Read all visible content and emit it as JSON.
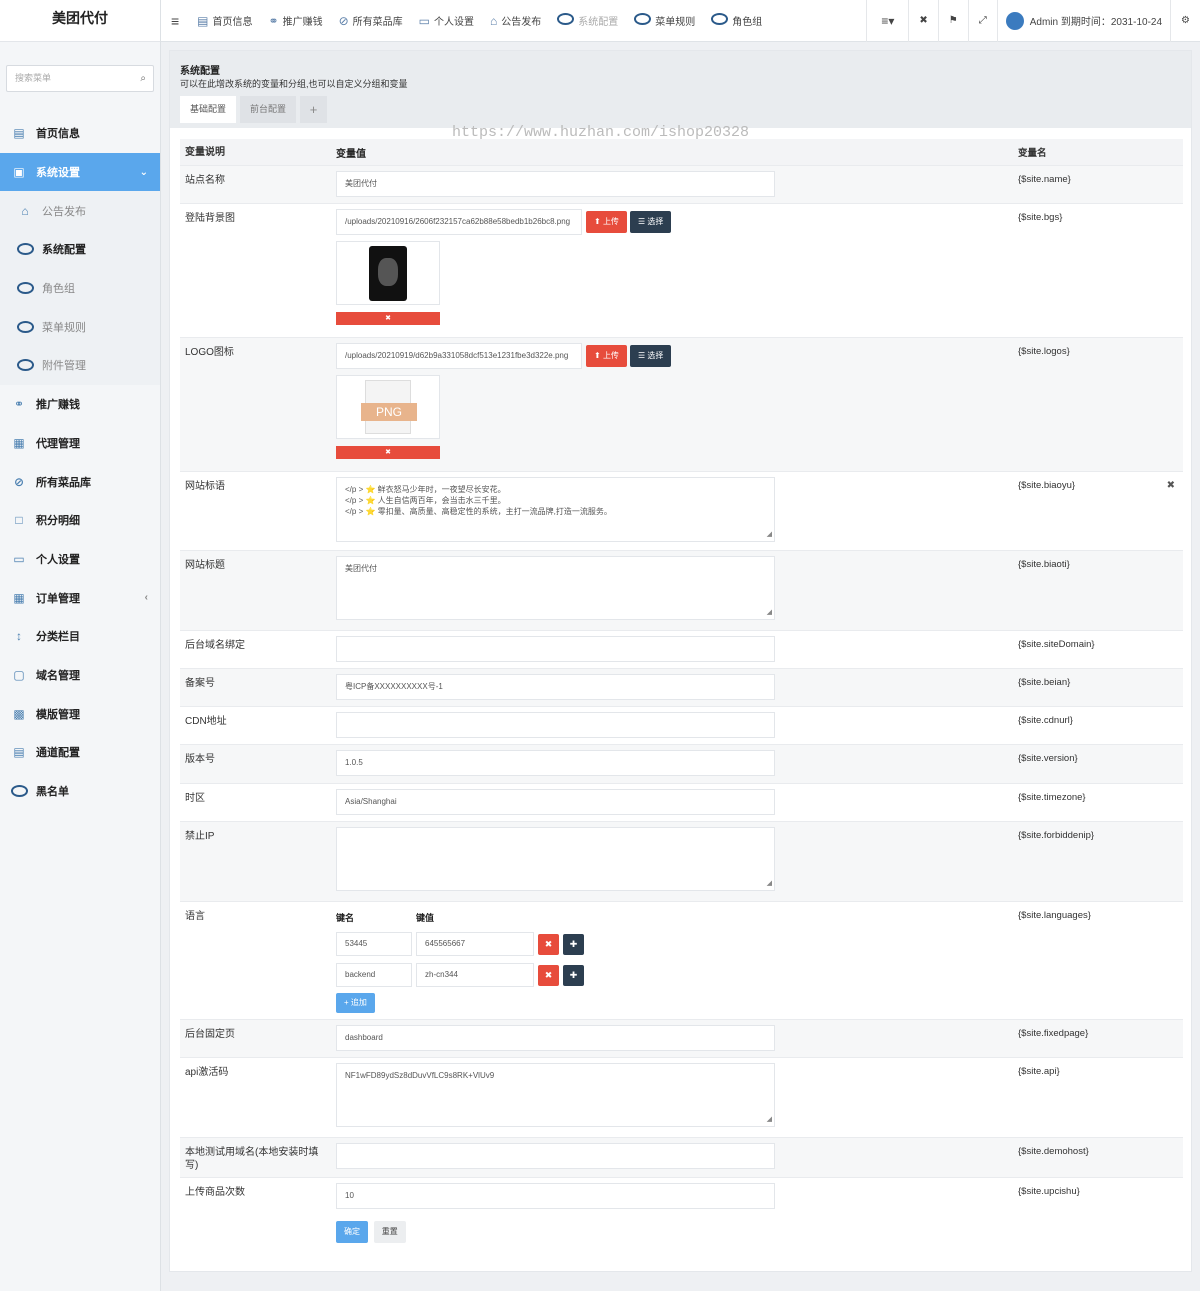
{
  "sidebar": {
    "brand": "美团代付",
    "search_placeholder": "搜索菜单",
    "items": [
      {
        "label": "首页信息",
        "icon": "home-icon"
      },
      {
        "label": "系统设置",
        "icon": "settings-icon",
        "active": true
      },
      {
        "label": "公告发布",
        "icon": "announce-icon"
      },
      {
        "label": "系统配置",
        "icon": "circle-icon",
        "current": true
      },
      {
        "label": "角色组",
        "icon": "circle-icon"
      },
      {
        "label": "菜单规则",
        "icon": "circle-icon"
      },
      {
        "label": "附件管理",
        "icon": "circle-icon"
      },
      {
        "label": "推广赚钱",
        "icon": "promote-icon"
      },
      {
        "label": "代理管理",
        "icon": "agent-icon"
      },
      {
        "label": "所有菜品库",
        "icon": "dishes-icon"
      },
      {
        "label": "积分明细",
        "icon": "points-icon"
      },
      {
        "label": "个人设置",
        "icon": "profile-icon"
      },
      {
        "label": "订单管理",
        "icon": "order-icon"
      },
      {
        "label": "分类栏目",
        "icon": "category-icon"
      },
      {
        "label": "域名管理",
        "icon": "domain-icon"
      },
      {
        "label": "模版管理",
        "icon": "template-icon"
      },
      {
        "label": "通道配置",
        "icon": "channel-icon"
      },
      {
        "label": "黑名单",
        "icon": "circle-icon"
      }
    ]
  },
  "topbar": {
    "menu_toggle": "≡",
    "tabs": [
      "首页信息",
      "推广赚钱",
      "所有菜品库",
      "个人设置",
      "公告发布",
      "系统配置",
      "菜单规则",
      "角色组"
    ],
    "admin": "Admin 到期时间：2031-10-24"
  },
  "panel": {
    "title": "系统配置",
    "subtitle": "可以在此增改系统的变量和分组,也可以自定义分组和变量",
    "tabs": [
      "基础配置",
      "前台配置"
    ],
    "watermark": "https://www.huzhan.com/ishop20328",
    "headers": {
      "desc": "变量说明",
      "value": "变量值",
      "name": "变量名"
    },
    "upload_label": "上传",
    "choose_label": "选择",
    "rows": {
      "site_name": {
        "label": "站点名称",
        "value": "美团代付",
        "var": "{$site.name}"
      },
      "bgs": {
        "label": "登陆背景图",
        "value": "/uploads/20210916/2606f232157ca62b88e58bedb1b26bc8.png",
        "var": "{$site.bgs}"
      },
      "logos": {
        "label": "LOGO图标",
        "value": "/uploads/20210919/d62b9a331058dcf513e1231fbe3d322e.png",
        "var": "{$site.logos}",
        "thumb_text": "PNG"
      },
      "biaoyu": {
        "label": "网站标语",
        "line1": "</p > ⭐ 鲜衣怒马少年时，一夜望尽长安花。",
        "line2": "</p > ⭐ 人生自信两百年，会当击水三千里。",
        "line3": "</p > ⭐ 零扣量、高质量、高稳定性的系统，主打一流品牌,打造一流服务。",
        "var": "{$site.biaoyu}"
      },
      "biaoti": {
        "label": "网站标题",
        "value": "美团代付",
        "var": "{$site.biaoti}"
      },
      "domain": {
        "label": "后台域名绑定",
        "value": "",
        "var": "{$site.siteDomain}"
      },
      "beian": {
        "label": "备案号",
        "value": "粤ICP备XXXXXXXXXX号-1",
        "var": "{$site.beian}"
      },
      "cdn": {
        "label": "CDN地址",
        "value": "",
        "var": "{$site.cdnurl}"
      },
      "version": {
        "label": "版本号",
        "value": "1.0.5",
        "var": "{$site.version}"
      },
      "timezone": {
        "label": "时区",
        "value": "Asia/Shanghai",
        "var": "{$site.timezone}"
      },
      "forbidden": {
        "label": "禁止IP",
        "value": "",
        "var": "{$site.forbiddenip}"
      },
      "languages": {
        "label": "语言",
        "key_header": "键名",
        "val_header": "键值",
        "pairs": [
          {
            "key": "53445",
            "val": "645565667"
          },
          {
            "key": "backend",
            "val": "zh-cn344"
          }
        ],
        "add_label": "追加",
        "var": "{$site.languages}"
      },
      "fixedpage": {
        "label": "后台固定页",
        "value": "dashboard",
        "var": "{$site.fixedpage}"
      },
      "api": {
        "label": "api激活码",
        "value": "NF1wFD89ydSz8dDuvVfLC9s8RK+VlUv9",
        "var": "{$site.api}"
      },
      "demohost": {
        "label": "本地测试用域名(本地安装时填写)",
        "value": "",
        "var": "{$site.demohost}"
      },
      "upcishu": {
        "label": "上传商品次数",
        "value": "10",
        "var": "{$site.upcishu}"
      }
    },
    "submit_label": "确定",
    "reset_label": "重置"
  }
}
